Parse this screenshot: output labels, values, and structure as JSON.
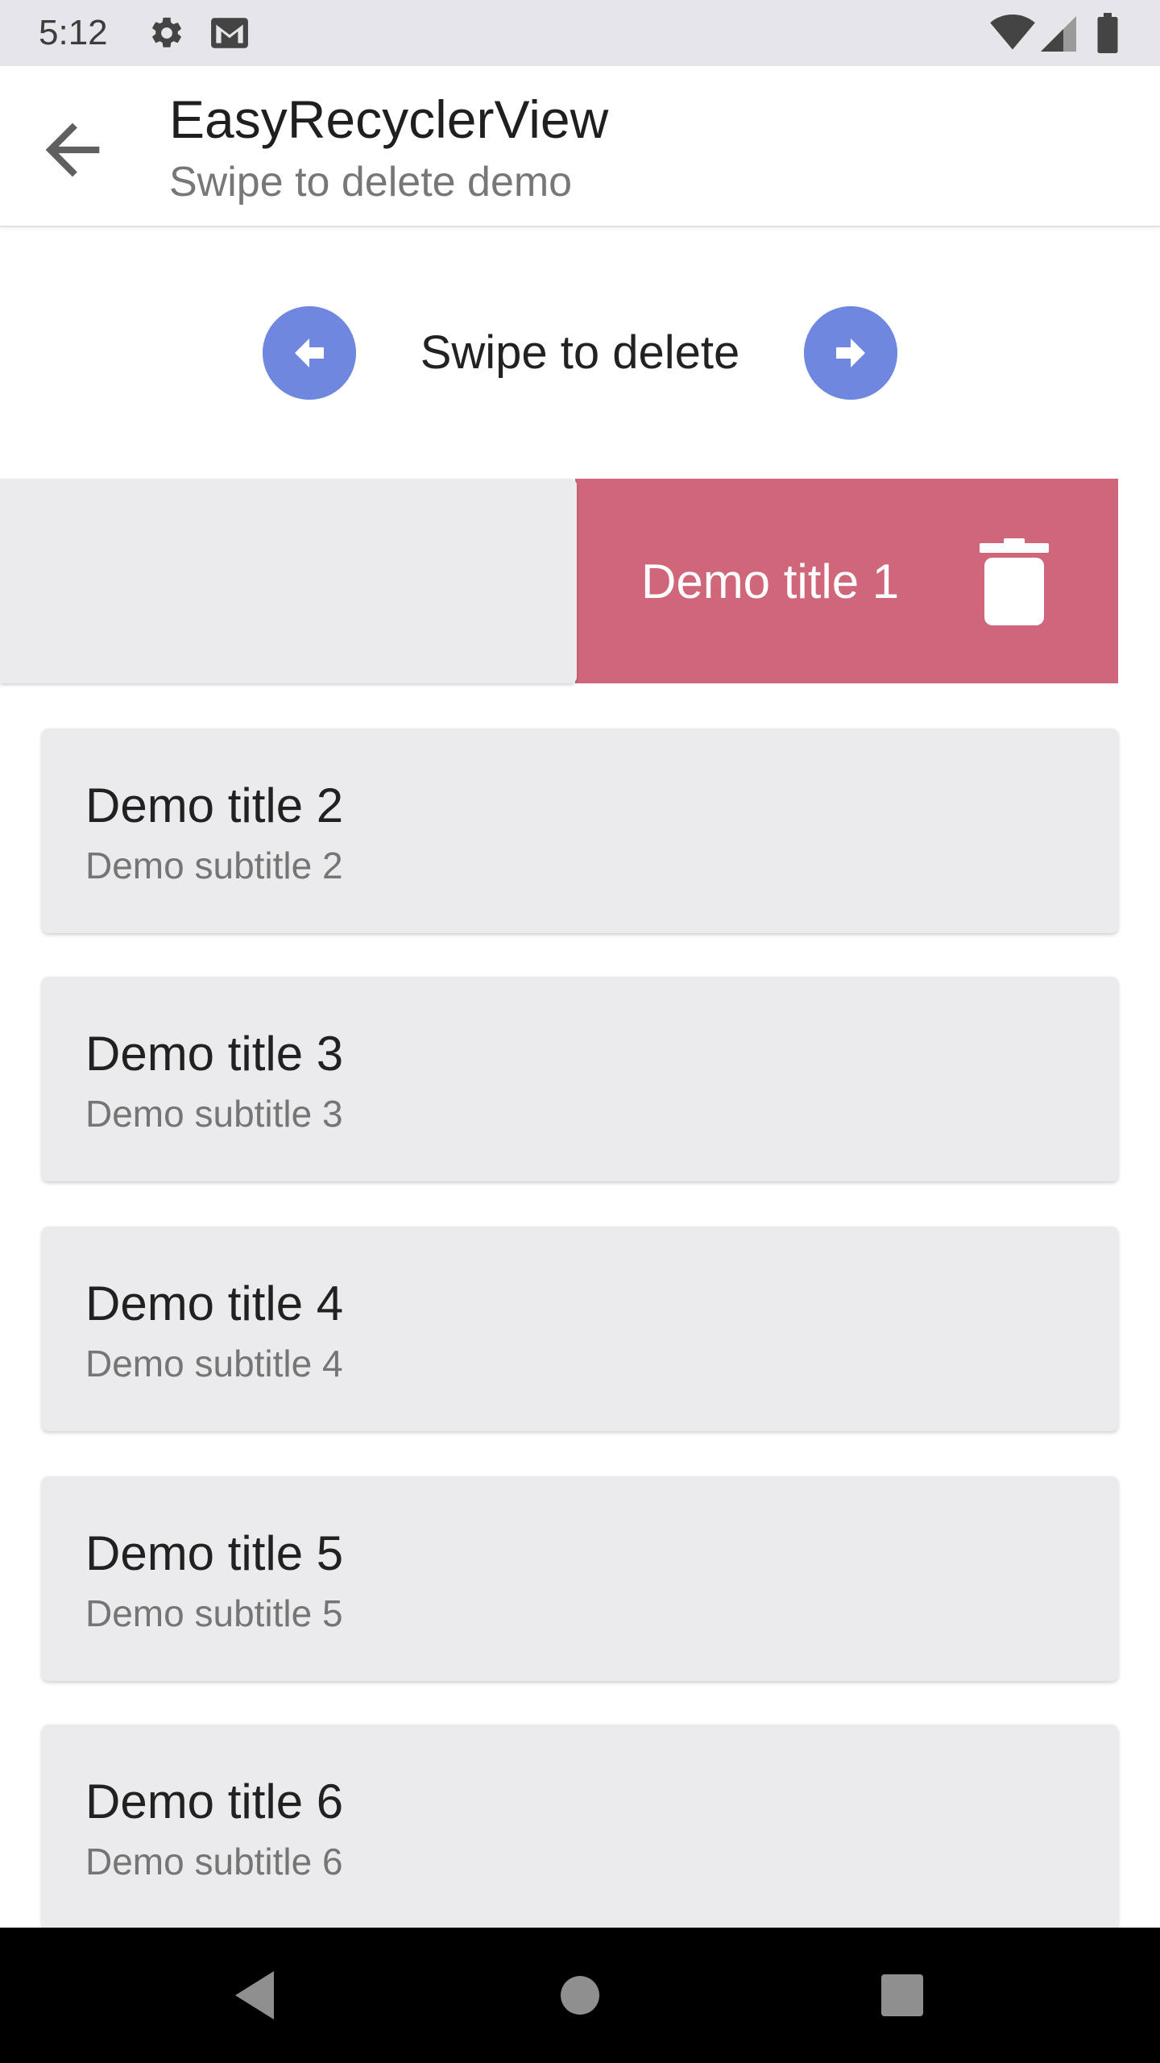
{
  "status_bar": {
    "time": "5:12",
    "icons": [
      "gear-icon",
      "gmail-icon",
      "wifi-icon",
      "signal-icon",
      "battery-icon"
    ]
  },
  "app_bar": {
    "title": "EasyRecyclerView",
    "subtitle": "Swipe to delete demo",
    "back_icon": "arrow-back-icon"
  },
  "swipe_hint": {
    "text": "Swipe to delete",
    "left_icon": "arrow-left-circle-icon",
    "right_icon": "arrow-right-circle-icon",
    "accent_color": "#6f87df"
  },
  "swiped_item": {
    "title": "Demo title 1",
    "action_icon": "trash-icon",
    "delete_color": "#cf6679"
  },
  "items": [
    {
      "title": "Demo title 2",
      "subtitle": "Demo subtitle 2"
    },
    {
      "title": "Demo title 3",
      "subtitle": "Demo subtitle 3"
    },
    {
      "title": "Demo title 4",
      "subtitle": "Demo subtitle 4"
    },
    {
      "title": "Demo title 5",
      "subtitle": "Demo subtitle 5"
    },
    {
      "title": "Demo title 6",
      "subtitle": "Demo subtitle 6"
    }
  ],
  "nav_bar": {
    "icons": [
      "nav-back-icon",
      "nav-home-icon",
      "nav-recents-icon"
    ]
  }
}
